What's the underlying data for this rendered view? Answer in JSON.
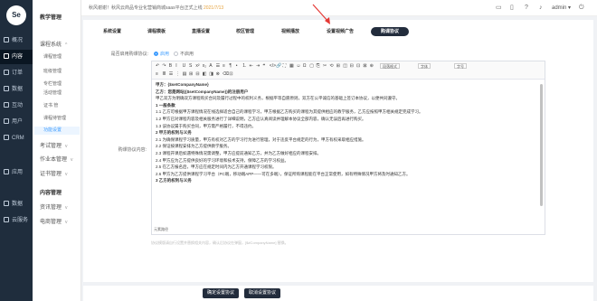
{
  "logo": {
    "text": "Se"
  },
  "rail": {
    "items": [
      {
        "label": "概况",
        "active": false
      },
      {
        "label": "内容",
        "active": true
      },
      {
        "label": "订单",
        "active": false
      },
      {
        "label": "数据",
        "active": false
      },
      {
        "label": "互动",
        "active": false
      },
      {
        "label": "用户",
        "active": false
      },
      {
        "label": "CRM",
        "active": false
      },
      {
        "label": "应用",
        "active": false
      },
      {
        "label": "数据",
        "active": false
      },
      {
        "label": "云服务",
        "active": false
      }
    ]
  },
  "submenu": {
    "group1": "教学管理",
    "section1": "课程系统",
    "items1": [
      "课程管理",
      "班级管理",
      "专栏管理",
      "活动管理",
      "证书 管",
      "课程待管理",
      "功能设置"
    ],
    "active_index": 6,
    "sections": [
      "考试管理",
      "作业本管理",
      "证书管理"
    ],
    "group2": "内容管理",
    "sections2": [
      "资讯管理",
      "电商管理"
    ]
  },
  "topbar": {
    "notice": "秋风谢谢！秋风云商品专业化营销商城saas平台正式上线",
    "notice_date": "2021/7/13",
    "user": "admin"
  },
  "tabs": [
    {
      "label": "系统设置",
      "active": false
    },
    {
      "label": "课程模板",
      "active": false
    },
    {
      "label": "直播设置",
      "active": false
    },
    {
      "label": "校区管理",
      "active": false
    },
    {
      "label": "视频播放",
      "active": false
    },
    {
      "label": "设置视频广告",
      "active": false
    },
    {
      "label": "购课协议",
      "active": true
    }
  ],
  "form": {
    "agreement_toggle_label": "是否启用购课协议:",
    "radio_on": "启用",
    "radio_off": "不启用",
    "content_label": "购课协议内容:",
    "hint": "协议模版请自行设置并替换相关内容，确认后协议在弹窗，[$#CompanyName] 替换。"
  },
  "toolbar": {
    "row1": [
      "↶",
      "↷",
      "B",
      "I",
      "U",
      "S",
      "x²",
      "x₂",
      "A",
      "☰",
      "≡",
      "¶",
      "•",
      "1.",
      "⇤",
      "⇥",
      "❝",
      "</>",
      "🔗",
      "⛶",
      "▦",
      "☺",
      "Ω",
      "▢",
      "⎘",
      "✂",
      "⟲",
      "⊞",
      "◫",
      "⊟",
      "⊡",
      "⊠",
      "⊕"
    ],
    "sel1": "段落格式",
    "sel2": "字体",
    "sel3": "字号",
    "row2": [
      "≡",
      "≣",
      "☰",
      "⋮",
      "▤",
      "⊞",
      "⊟",
      "◧",
      "◨",
      "⊗",
      "⌫",
      "⊡"
    ]
  },
  "doc": {
    "lines": [
      {
        "text": "甲方：{$setCompanyName}",
        "bold": true
      },
      {
        "text": "乙方：您是网站({$setCompanyName})的注册用户",
        "bold": true
      },
      {
        "text": "甲乙双方为明确双方课程购买合同及履行过程中的权利义务，根据平等自愿原则，双方在公平诚信的基础上签订本协议，以便共同遵守。",
        "bold": false
      },
      {
        "text": "1 一般条款",
        "bold": true
      },
      {
        "text": "1.1 乙方可根据甲方课程情况在线选择适合自己的课程学习，甲方根据乙方购买的课程为其提供相应的教学服务，乙方应按照甲方相关规定完成学习。",
        "bold": false
      },
      {
        "text": "1.2 甲方已对课程内容及相关服务进行了详细说明，乙方应认真阅读并理解本协议全部内容，确认无误后再进行购买。",
        "bold": false
      },
      {
        "text": "1.3 该协议属于购买合同，甲方需严格履行，不得违约。",
        "bold": false
      },
      {
        "text": "2 甲方的权利与义务",
        "bold": true
      },
      {
        "text": "2.1 为确保课程学习质量，甲方有权对乙方的学习行为进行管理，对于违反平台规定的行为，甲方有权采取相应措施。",
        "bold": false
      },
      {
        "text": "2.2 保证按课程安排为乙方提供教学服务。",
        "bold": false
      },
      {
        "text": "2.3 课程开课后如遇特殊情况需调整，甲方应提前通知乙方，并为乙方做好相应的课程安排。",
        "bold": false
      },
      {
        "text": "2.4 甲方应为乙方提供良好的学习环境和技术支持，保障乙方的学习权益。",
        "bold": false
      },
      {
        "text": "2.5 在乙方报名后，甲方应在规定时间内为乙方开通课程学习权限。",
        "bold": false
      },
      {
        "text": "2.6 甲方为乙方提供课程学习平台（PC端，移动端APP——可在多端），保证所购课程能在平台正常使用，如有特殊情况甲方将及时通知乙方。",
        "bold": false
      },
      {
        "text": "3 乙方的权利与义务",
        "bold": true
      }
    ],
    "status": "元素路径"
  },
  "footer": {
    "confirm": "确定设置协议",
    "reset": "取消设置协议"
  },
  "colors": {
    "accent": "#409eff",
    "dark": "#222c3c",
    "arrow": "#e53935"
  }
}
